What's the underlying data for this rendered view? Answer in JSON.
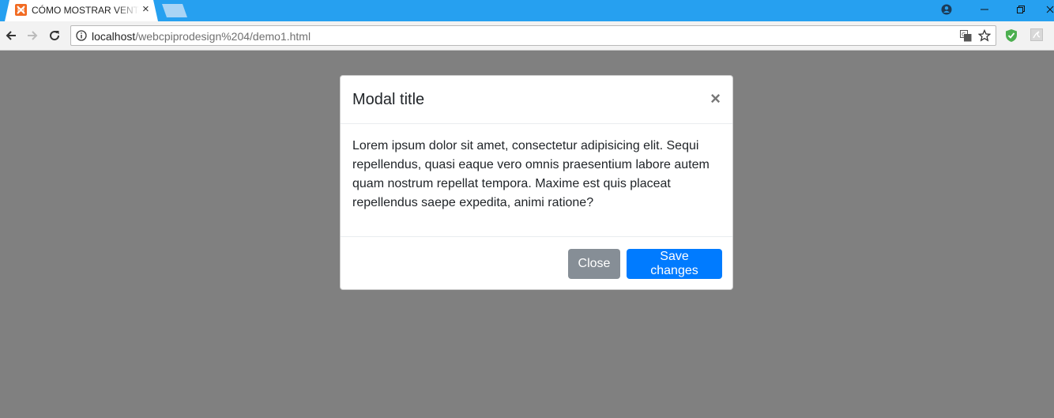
{
  "browser": {
    "tab_title": "CÓMO MOSTRAR VENTANAS MODALES",
    "tab_close": "×",
    "url_host": "localhost",
    "url_path": "/webcpiprodesign%204/demo1.html"
  },
  "modal": {
    "title": "Modal title",
    "close_glyph": "×",
    "body": "Lorem ipsum dolor sit amet, consectetur adipisicing elit. Sequi repellendus, quasi eaque vero omnis praesentium labore autem quam nostrum repellat tempora. Maxime est quis placeat repellendus saepe expedita, animi ratione?",
    "close_button": "Close",
    "save_button": "Save changes"
  },
  "colors": {
    "tab_strip": "#26a0f0",
    "backdrop": "#808080",
    "primary": "#007bff",
    "secondary": "#868e96",
    "shield": "#4caf50"
  },
  "icons": [
    "xampp-favicon-icon",
    "profile-icon",
    "minimize-icon",
    "restore-icon",
    "back-arrow-icon",
    "forward-arrow-icon",
    "reload-icon",
    "info-icon",
    "translate-icon",
    "star-icon",
    "shield-icon",
    "pdf-extension-icon"
  ]
}
